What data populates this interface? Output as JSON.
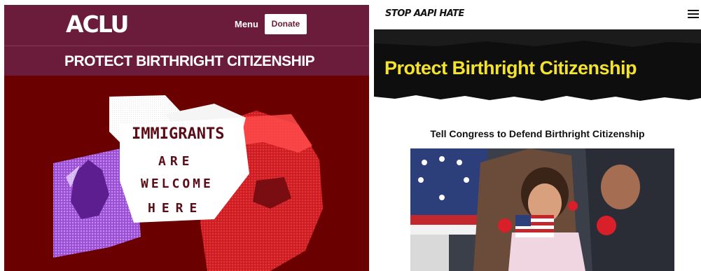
{
  "aclu": {
    "logo": "ACLU",
    "menu_label": "Menu",
    "donate_label": "Donate",
    "page_title": "PROTECT BIRTHRIGHT CITIZENSHIP",
    "sign": {
      "line1": "IMMIGRANTS",
      "line2": "ARE",
      "line3": "WELCOME",
      "line4": "HERE"
    },
    "colors": {
      "banner": "#6a1c3a",
      "background": "#6b0000",
      "accent_red": "#e8272b",
      "accent_purple": "#9b4dd6"
    }
  },
  "stop_aapi_hate": {
    "logo": "STOP AAPI HATE",
    "menu_icon": "hamburger-menu-icon",
    "hero_title": "Protect Birthright Citizenship",
    "subheading": "Tell Congress to Defend Birthright Citizenship",
    "colors": {
      "hero_bg": "#0e0e0e",
      "hero_text": "#f3e22e"
    }
  }
}
